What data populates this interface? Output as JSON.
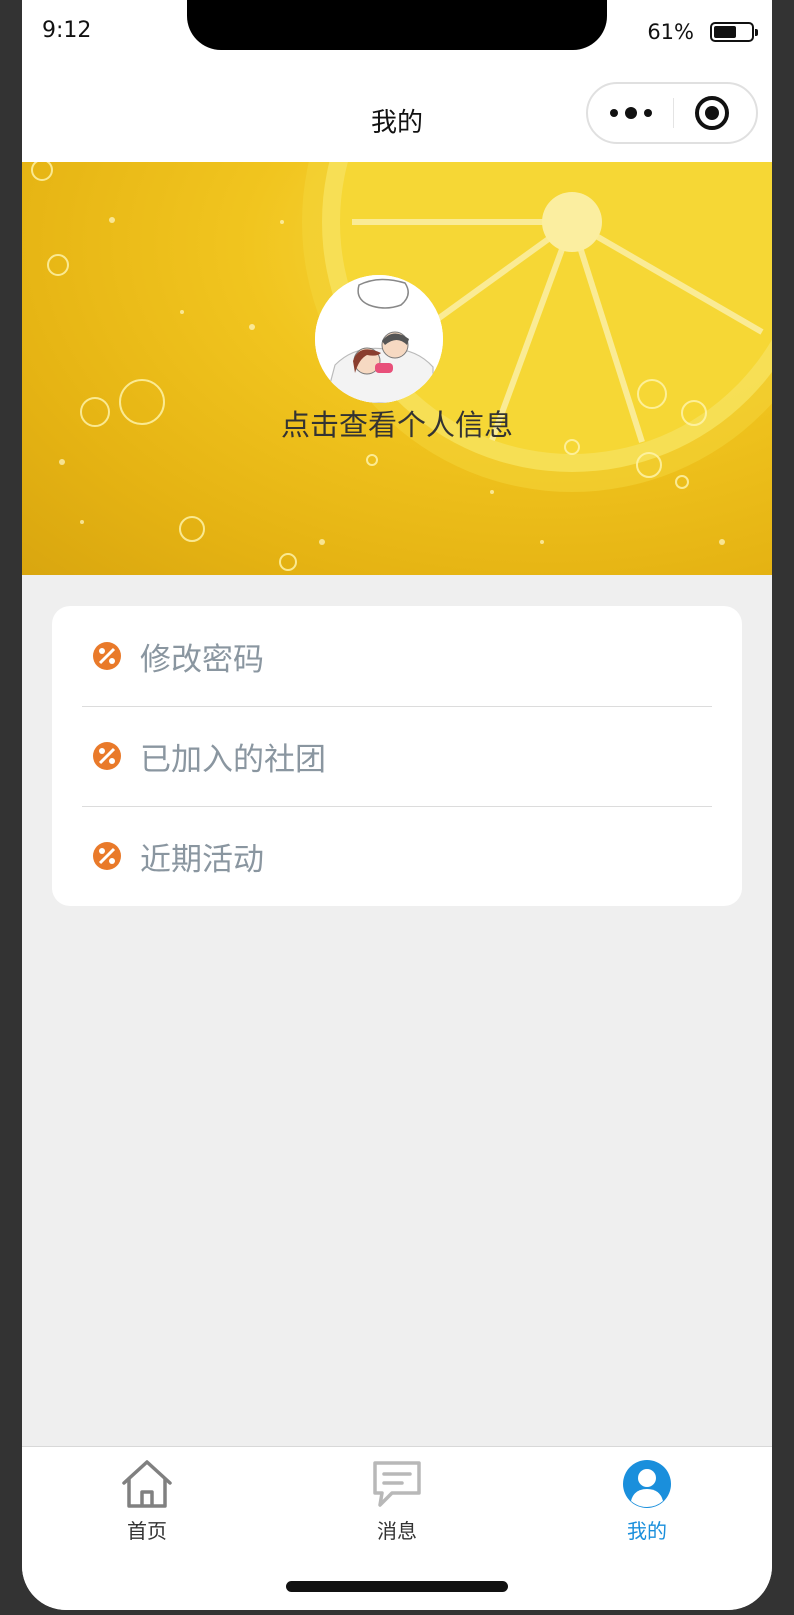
{
  "status_bar": {
    "time": "9:12",
    "battery_percent_text": "61%",
    "battery_level": 0.61
  },
  "nav": {
    "title": "我的",
    "more_icon": "more-dots-icon",
    "target_icon": "target-icon"
  },
  "profile": {
    "avatar_icon": "cartoon-couple-avatar",
    "link_text": "点击查看个人信息"
  },
  "menu": {
    "items": [
      {
        "label": "修改密码",
        "icon": "discount-icon"
      },
      {
        "label": "已加入的社团",
        "icon": "discount-icon"
      },
      {
        "label": "近期活动",
        "icon": "discount-icon"
      }
    ]
  },
  "tabbar": {
    "tabs": [
      {
        "label": "首页",
        "icon": "home-icon",
        "active": false
      },
      {
        "label": "消息",
        "icon": "message-icon",
        "active": false
      },
      {
        "label": "我的",
        "icon": "user-icon",
        "active": true
      }
    ]
  },
  "colors": {
    "accent": "#1a8fdc",
    "menu_icon": "#e97a2a",
    "menu_text": "#8a96a0",
    "banner": "#f1c51f",
    "page_bg": "#efefef"
  }
}
